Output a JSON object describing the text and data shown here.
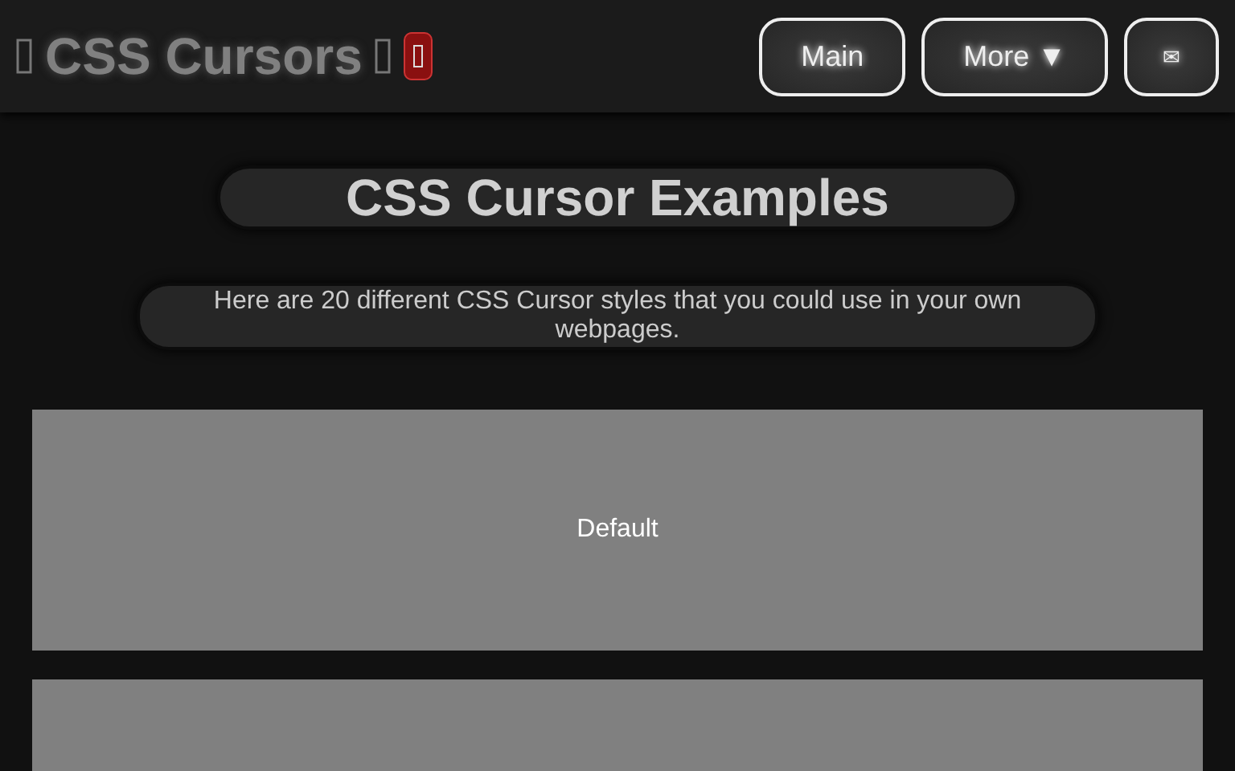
{
  "header": {
    "title": "CSS Cursors",
    "nav": [
      {
        "label": "Main",
        "kind": "text"
      },
      {
        "label": "More ▼",
        "kind": "text"
      },
      {
        "label": "✉",
        "kind": "icon"
      }
    ]
  },
  "heading": "CSS Cursor Examples",
  "intro": "Here are 20 different CSS Cursor styles that you could use in your own webpages.",
  "cards": [
    {
      "kind": "demo",
      "label": "Default"
    },
    {
      "kind": "demo"
    }
  ]
}
